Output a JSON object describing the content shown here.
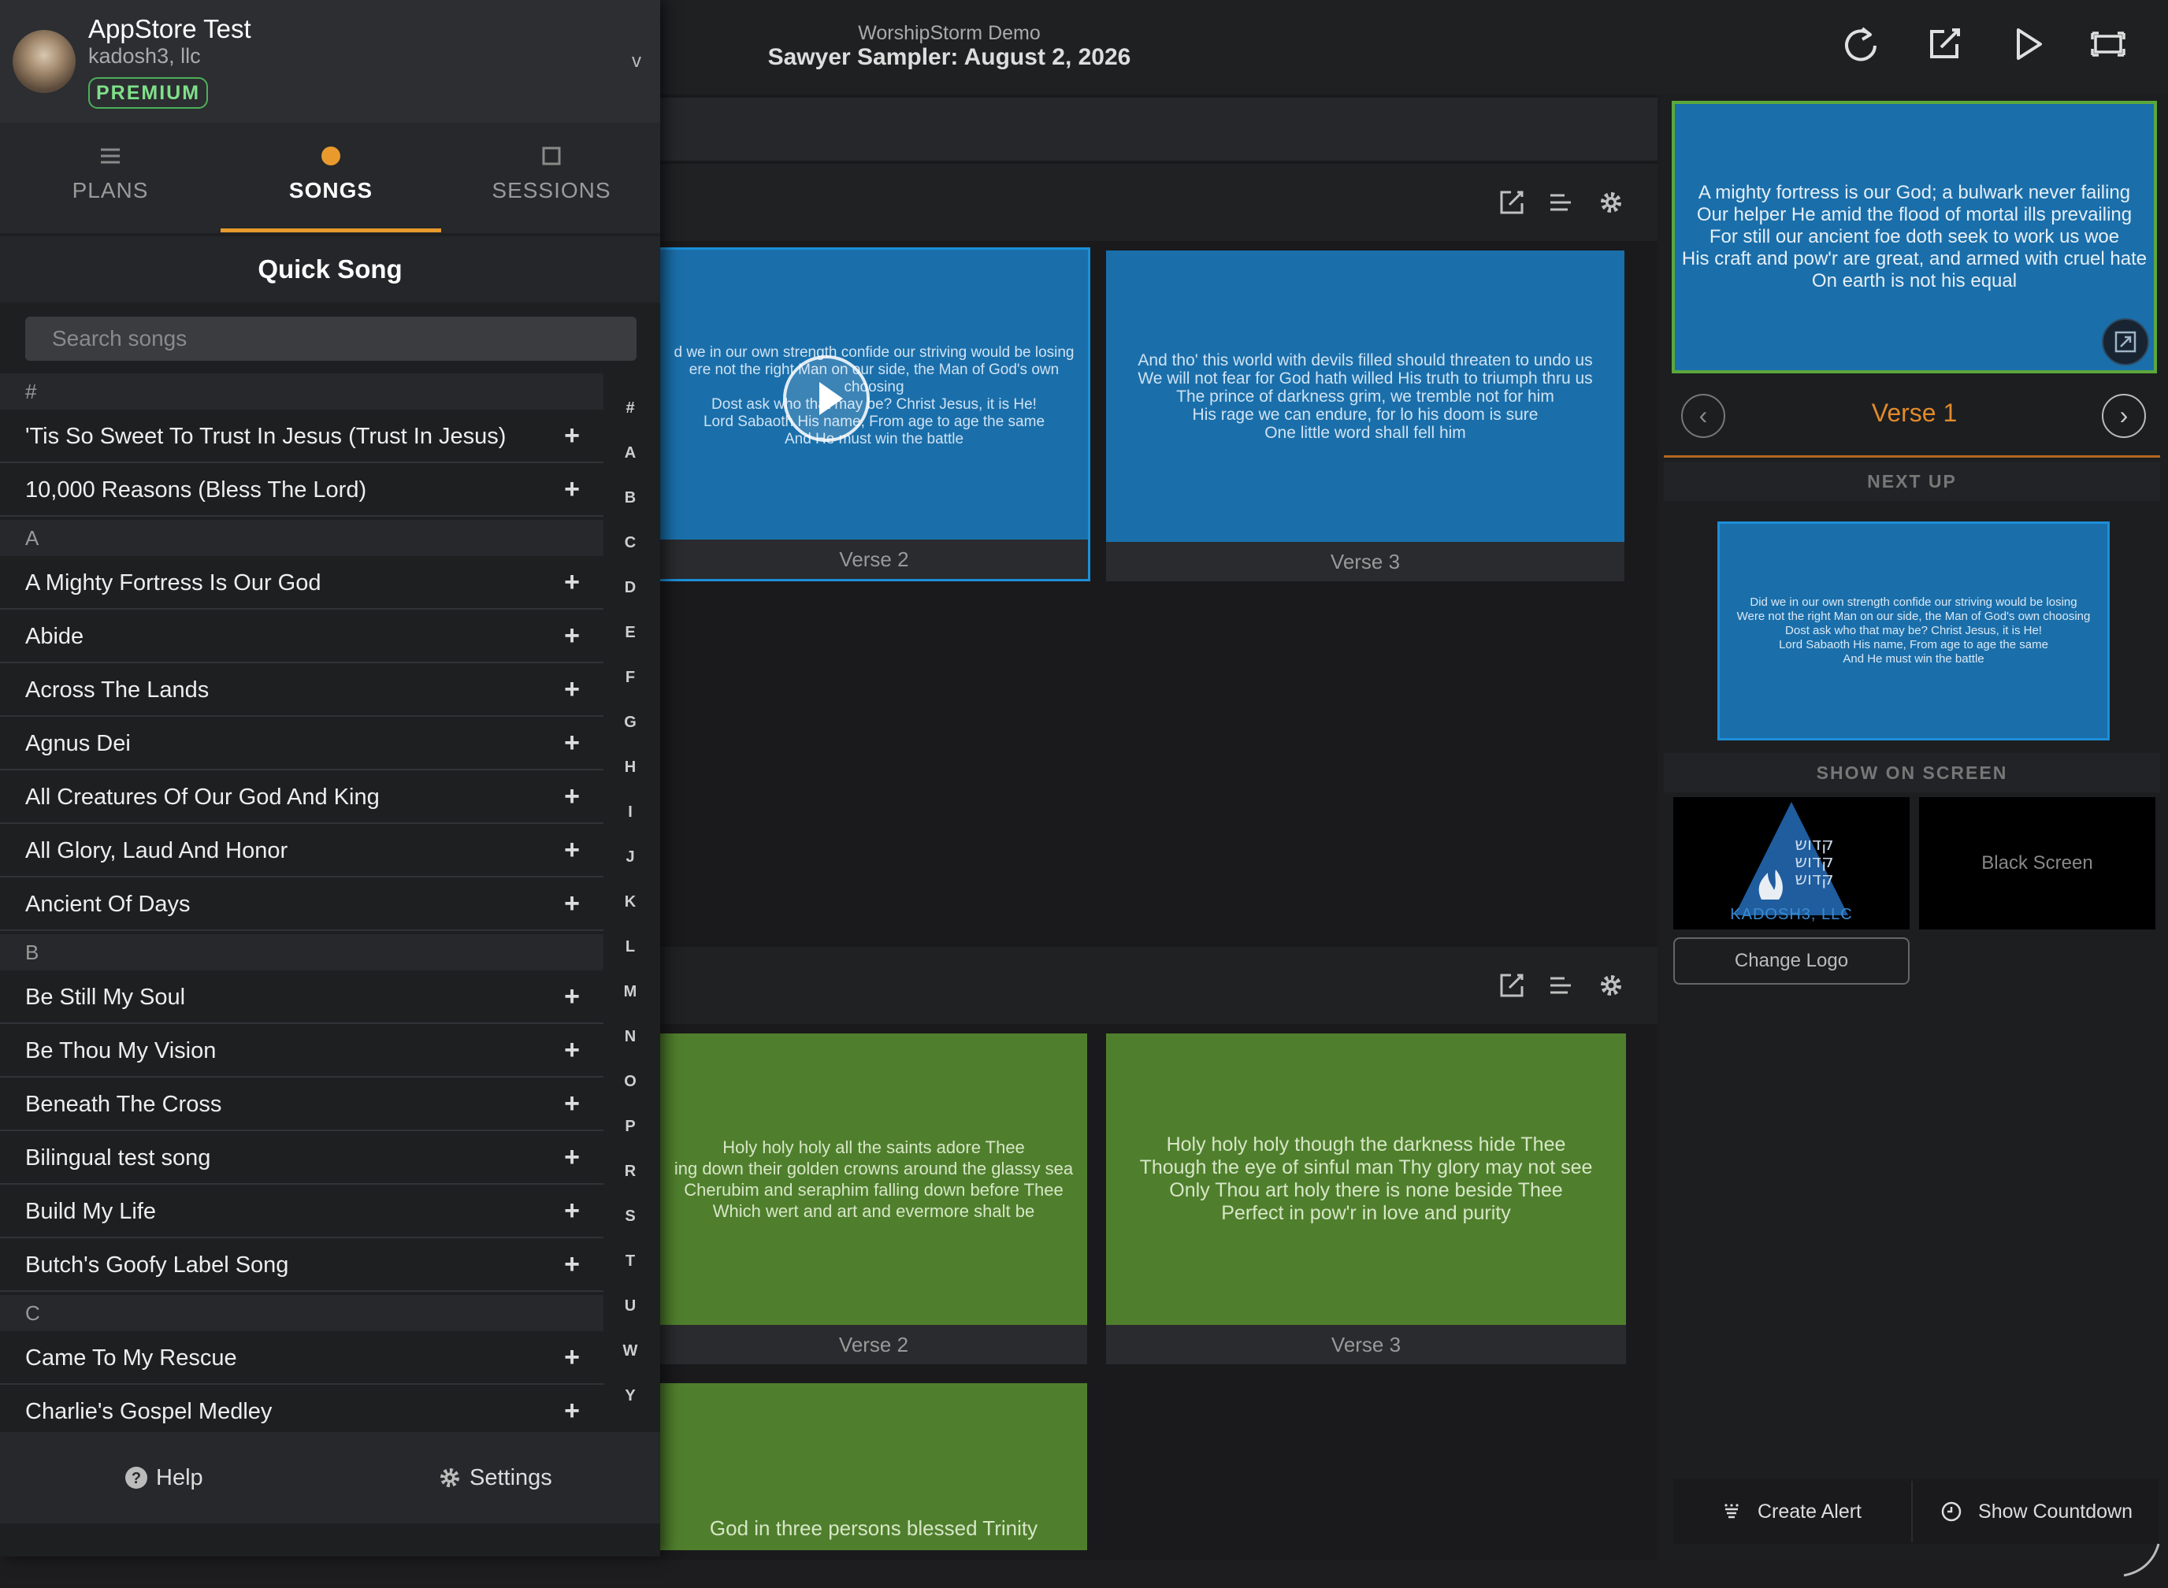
{
  "header": {
    "subtitle": "WorshipStorm Demo",
    "title": "Sawyer Sampler: August 2, 2026"
  },
  "account": {
    "name": "AppStore Test",
    "org": "kadosh3, llc",
    "badge": "PREMIUM",
    "chevron": "v"
  },
  "tabs": [
    {
      "label": "PLANS",
      "icon": "list-icon"
    },
    {
      "label": "SONGS",
      "icon": "dot-icon",
      "active": true
    },
    {
      "label": "SESSIONS",
      "icon": "square-icon"
    }
  ],
  "quick_song": {
    "title": "Quick Song",
    "search_placeholder": "Search songs"
  },
  "song_groups": [
    {
      "letter": "#",
      "songs": [
        "'Tis So Sweet To Trust In Jesus (Trust In Jesus)",
        "10,000 Reasons (Bless The Lord)"
      ]
    },
    {
      "letter": "A",
      "songs": [
        "A Mighty Fortress Is Our God",
        "Abide",
        "Across The Lands",
        "Agnus Dei",
        "All Creatures Of Our God And King",
        "All Glory, Laud And Honor",
        "Ancient Of Days"
      ]
    },
    {
      "letter": "B",
      "songs": [
        "Be Still My Soul",
        "Be Thou My Vision",
        "Beneath The Cross",
        "Bilingual test song",
        "Build My Life",
        "Butch's Goofy Label Song"
      ]
    },
    {
      "letter": "C",
      "songs": [
        "Came To My Rescue",
        "Charlie's Gospel Medley"
      ]
    }
  ],
  "index_letters": [
    "#",
    "A",
    "B",
    "C",
    "D",
    "E",
    "F",
    "G",
    "H",
    "I",
    "J",
    "K",
    "L",
    "M",
    "N",
    "O",
    "P",
    "R",
    "S",
    "T",
    "U",
    "W",
    "Y"
  ],
  "footer": {
    "help": "Help",
    "settings": "Settings"
  },
  "section1": {
    "slides": [
      {
        "caption": "Verse 2",
        "lines": [
          "d we in our own strength confide our striving would be losing",
          "ere not the right Man on our side, the Man of God's own choosing",
          "Dost ask who that may be? Christ Jesus, it is He!",
          "Lord Sabaoth His name, From age to age the same",
          "And He must win the battle"
        ]
      },
      {
        "caption": "Verse 3",
        "lines": [
          "And tho' this world with devils filled should threaten to undo us",
          "We will not fear for God hath willed His truth to triumph thru us",
          "The prince of darkness grim, we tremble not for him",
          "His rage we can endure, for lo his doom is sure",
          "One little word shall fell him"
        ]
      }
    ]
  },
  "section2": {
    "slides": [
      {
        "caption": "Verse 2",
        "lines": [
          "Holy holy holy all the saints adore Thee",
          "ing down their golden crowns around the glassy sea",
          "Cherubim and seraphim falling down before Thee",
          "Which wert and art and evermore shalt be"
        ]
      },
      {
        "caption": "Verse 3",
        "lines": [
          "Holy holy holy though the darkness hide Thee",
          "Though the eye of sinful man Thy glory may not see",
          "Only Thou art holy there is none beside Thee",
          "Perfect in pow'r in love and purity"
        ]
      },
      {
        "caption": "",
        "lines": [
          "God in three persons blessed Trinity"
        ]
      }
    ]
  },
  "live": {
    "lines": [
      "A mighty fortress is our God; a bulwark never failing",
      "Our helper He amid the flood of mortal ills prevailing",
      "For still our ancient foe doth seek to work us woe",
      "His craft and pow'r are great, and armed with cruel hate",
      "On earth is not his equal"
    ],
    "verse": "Verse 1"
  },
  "next_up": {
    "title": "NEXT UP",
    "lines": [
      "Did we in our own strength confide our striving would be losing",
      "Were not the right Man on our side, the Man of God's own choosing",
      "Dost ask who that may be? Christ Jesus, it is He!",
      "Lord Sabaoth His name, From age to age the same",
      "And He must win the battle"
    ]
  },
  "show_on_screen": {
    "title": "SHOW ON SCREEN",
    "logo_text": "KADOSH3, LLC",
    "logo_hebrew": [
      "קדוש",
      "קדוש",
      "קדוש"
    ],
    "black_screen": "Black Screen",
    "change_logo": "Change Logo"
  },
  "tools": {
    "create_alert": "Create Alert",
    "show_countdown": "Show Countdown"
  },
  "colors": {
    "accent": "#e89a2c",
    "slide_blue": "#1a6faa",
    "slide_green": "#4f7f2d",
    "live_border": "#5ca83b"
  }
}
